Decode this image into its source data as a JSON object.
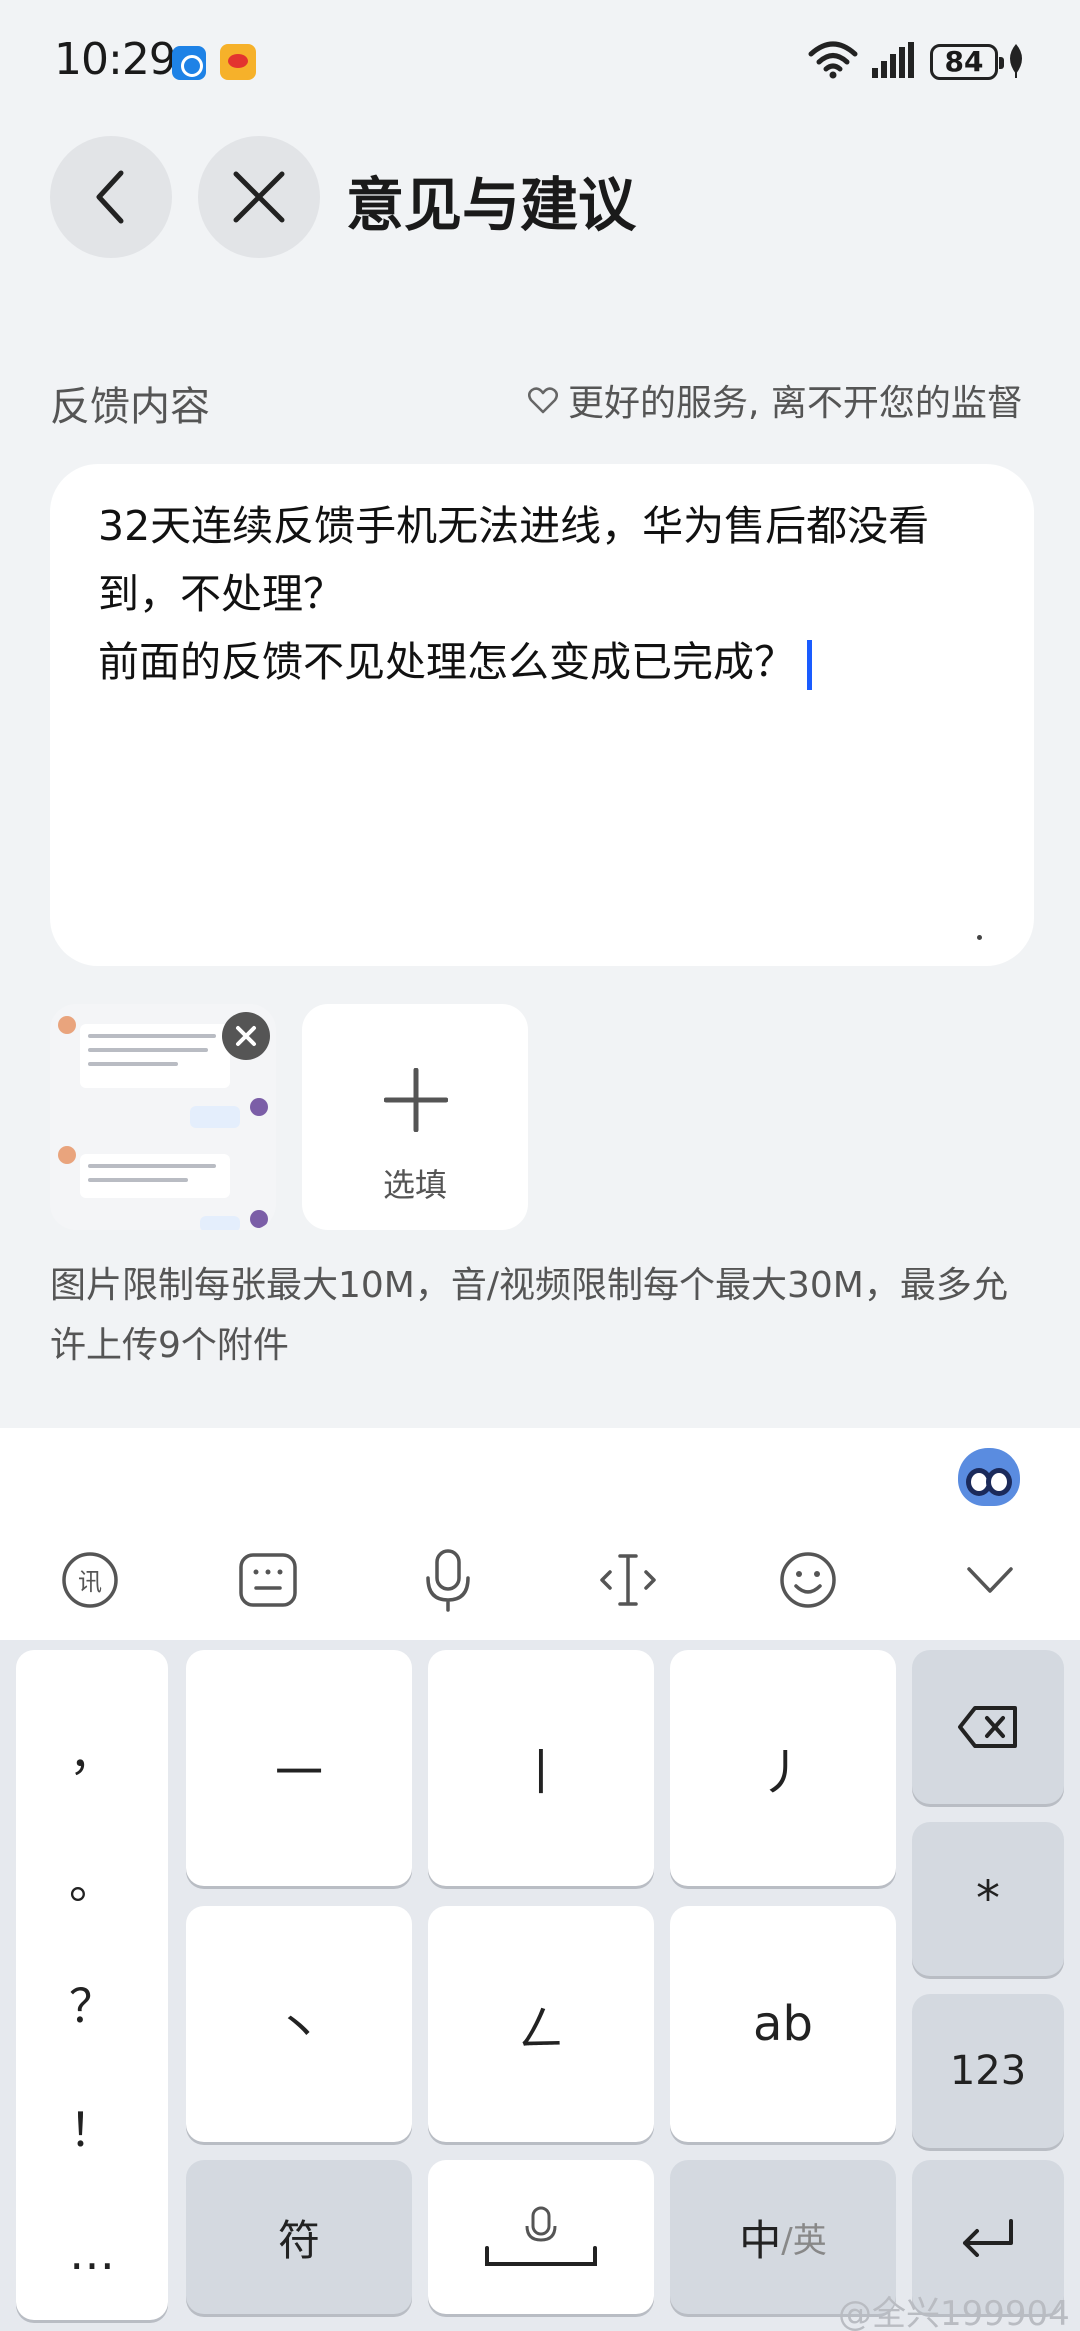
{
  "status_bar": {
    "time": "10:29",
    "battery": "84",
    "icons": [
      "app-notification-icon",
      "weibo-icon",
      "wifi-icon",
      "signal-icon",
      "battery-icon",
      "leaf-icon"
    ]
  },
  "header": {
    "title": "意见与建议",
    "back_icon": "chevron-left-icon",
    "close_icon": "close-icon"
  },
  "feedback": {
    "section_label": "反馈内容",
    "hint": "更好的服务, 离不开您的监督",
    "hint_icon": "heart-icon",
    "content": "32天连续反馈手机无法进线，华为售后都没看到，不处理？\n前面的反馈不见处理怎么变成已完成？"
  },
  "attachments": {
    "add_label": "选填",
    "limit_text": "图片限制每张最大10M，音/视频限制每个最大30M，最多允许上传9个附件"
  },
  "keyboard": {
    "toolbar_icons": [
      "xunfei-logo-icon",
      "keyboard-icon",
      "microphone-icon",
      "cursor-move-icon",
      "emoji-icon",
      "collapse-chevron-icon"
    ],
    "punctuation": [
      "，",
      "。",
      "？",
      "！",
      "…"
    ],
    "stroke_keys": [
      "一",
      "丨",
      "丿",
      "丶",
      "ㄥ",
      "ab"
    ],
    "right_keys": [
      "*",
      "123"
    ],
    "bottom_keys": {
      "symbols": "符",
      "lang_main": "中",
      "lang_sub": "/英"
    }
  },
  "watermark": "@全兴199904"
}
